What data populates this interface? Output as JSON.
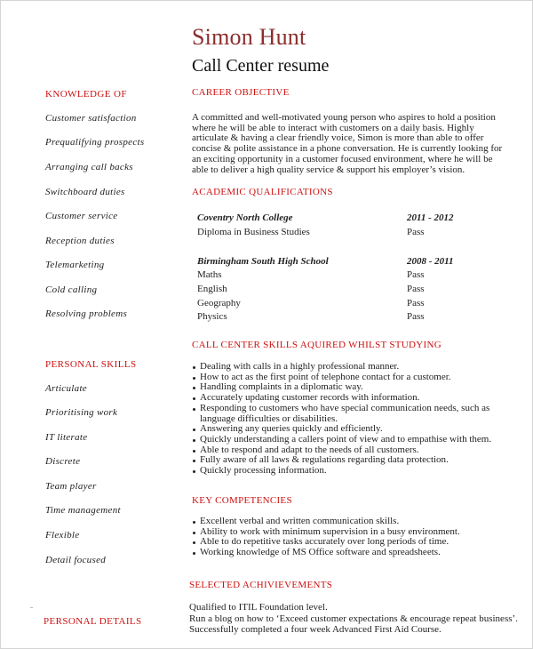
{
  "header": {
    "name": "Simon Hunt",
    "title": "Call Center resume"
  },
  "colors": {
    "name": "#8b2d2d",
    "heading": "#cc1111",
    "text": "#222222"
  },
  "left_column": {
    "knowledge": {
      "heading": "KNOWLEDGE OF",
      "items": [
        "Customer satisfaction",
        "Prequalifying prospects",
        "Arranging call backs",
        "Switchboard duties",
        "Customer service",
        "Reception duties",
        "Telemarketing",
        "Cold calling",
        "Resolving problems"
      ]
    },
    "personal_skills": {
      "heading": "PERSONAL SKILLS",
      "items": [
        "Articulate",
        "Prioritising work",
        "IT literate",
        "Discrete",
        "Team player",
        "Time management",
        "Flexible",
        "Detail focused"
      ]
    },
    "personal_details": {
      "heading": "PERSONAL DETAILS"
    }
  },
  "career_objective": {
    "heading": "CAREER OBJECTIVE",
    "lines": [
      "A committed and well-motivated young person who aspires to hold a position",
      "where he will be able to interact with customers on a daily basis. Highly",
      "articulate & having a clear friendly voice, Simon is more than able to offer",
      "concise & polite assistance in a phone conversation. He is currently looking for",
      "an exciting opportunity in a customer focused environment, where he will be",
      "able to deliver a high quality service & support his employer’s vision."
    ]
  },
  "academic": {
    "heading": "ACADEMIC QUALIFICATIONS",
    "institutions": [
      {
        "name": "Coventry North College",
        "years": "2011 - 2012",
        "subjects": [
          {
            "subject": "Diploma in Business Studies",
            "result": "Pass"
          }
        ]
      },
      {
        "name": "Birmingham South High School",
        "years": "2008 - 2011",
        "subjects": [
          {
            "subject": "Maths",
            "result": "Pass"
          },
          {
            "subject": "English",
            "result": "Pass"
          },
          {
            "subject": "Geography",
            "result": "Pass"
          },
          {
            "subject": "Physics",
            "result": "Pass"
          }
        ]
      }
    ]
  },
  "call_center_skills": {
    "heading": "CALL CENTER SKILLS AQUIRED WHILST STUDYING",
    "items": [
      "Dealing with calls in a highly professional manner.",
      "How to act as the first point of telephone contact for a customer.",
      "Handling complaints in a diplomatic way.",
      "Accurately updating customer records with information.",
      "Responding to customers who have special communication needs, such as",
      "Answering any queries quickly and efficiently.",
      "Quickly understanding a callers point of view and to empathise with them.",
      "Able to respond and adapt to the needs of all customers.",
      "Fully aware of all laws & regulations regarding data protection.",
      "Quickly processing information."
    ],
    "continuation": "language difficulties or disabilities."
  },
  "key_competencies": {
    "heading": "KEY COMPETENCIES",
    "items": [
      "Excellent verbal and written communication skills.",
      "Ability to work with minimum supervision in a busy environment.",
      "Able to do repetitive tasks accurately over long periods of time.",
      "Working knowledge of MS Office software and spreadsheets."
    ]
  },
  "achievements": {
    "heading": "SELECTED ACHIVIEVEMENTS",
    "lines": [
      "Qualified to ITIL Foundation level.",
      "Run a blog on how to ‘Exceed customer expectations & encourage repeat business’.",
      "Successfully completed a  four week Advanced First Aid Course."
    ]
  }
}
